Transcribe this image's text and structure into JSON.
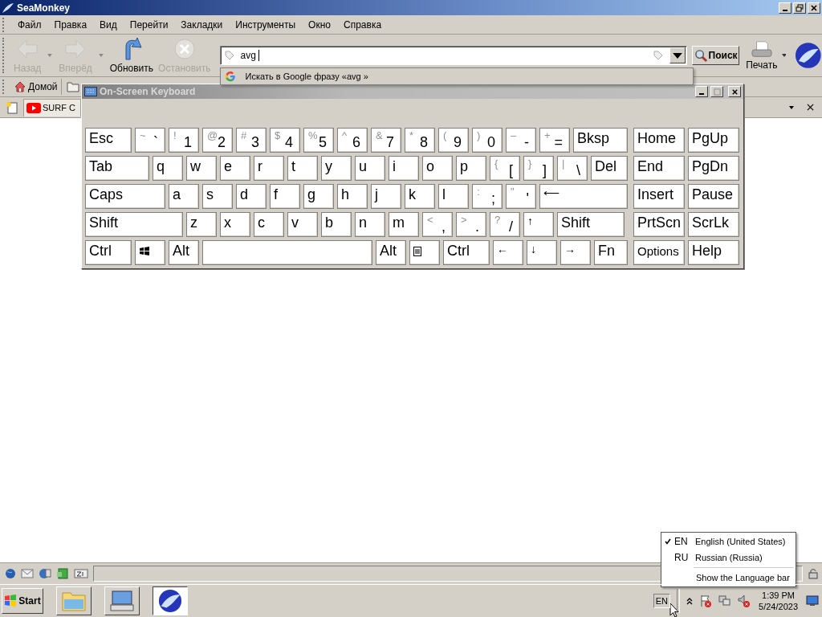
{
  "window": {
    "title": "SeaMonkey"
  },
  "menu": [
    "Файл",
    "Правка",
    "Вид",
    "Перейти",
    "Закладки",
    "Инструменты",
    "Окно",
    "Справка"
  ],
  "nav_buttons": [
    {
      "kind": "back",
      "label": "Назад",
      "disabled": true,
      "dropdown": true
    },
    {
      "kind": "forward",
      "label": "Вперёд",
      "disabled": true,
      "dropdown": true
    },
    {
      "kind": "reload",
      "label": "Обновить",
      "disabled": false,
      "dropdown": false
    },
    {
      "kind": "stop",
      "label": "Остановить",
      "disabled": true,
      "dropdown": false
    }
  ],
  "url": {
    "value": "avg"
  },
  "suggestion": {
    "text": "Искать в Google фразу «avg »"
  },
  "search_button": "Поиск",
  "print_button": "Печать",
  "bookmarks": [
    {
      "label": "Домой"
    }
  ],
  "tabs": [
    {
      "label": "SURF C",
      "selected": true
    }
  ],
  "keyboard": {
    "title": "On-Screen Keyboard",
    "main_rows": [
      [
        {
          "label": "Esc"
        },
        {
          "shift": "~",
          "label": "`"
        },
        {
          "shift": "!",
          "label": "1"
        },
        {
          "shift": "@",
          "label": "2"
        },
        {
          "shift": "#",
          "label": "3"
        },
        {
          "shift": "$",
          "label": "4"
        },
        {
          "shift": "%",
          "label": "5"
        },
        {
          "shift": "^",
          "label": "6"
        },
        {
          "shift": "&",
          "label": "7"
        },
        {
          "shift": "*",
          "label": "8"
        },
        {
          "shift": "(",
          "label": "9"
        },
        {
          "shift": ")",
          "label": "0"
        },
        {
          "shift": "–",
          "label": "-"
        },
        {
          "shift": "+",
          "label": "="
        },
        {
          "label": "Bksp"
        }
      ],
      [
        {
          "label": "Tab"
        },
        {
          "label": "q"
        },
        {
          "label": "w"
        },
        {
          "label": "e"
        },
        {
          "label": "r"
        },
        {
          "label": "t"
        },
        {
          "label": "y"
        },
        {
          "label": "u"
        },
        {
          "label": "i"
        },
        {
          "label": "o"
        },
        {
          "label": "p"
        },
        {
          "shift": "{",
          "label": "["
        },
        {
          "shift": "}",
          "label": "]"
        },
        {
          "shift": "|",
          "label": "\\"
        },
        {
          "label": "Del"
        }
      ],
      [
        {
          "label": "Caps"
        },
        {
          "label": "a"
        },
        {
          "label": "s"
        },
        {
          "label": "d"
        },
        {
          "label": "f"
        },
        {
          "label": "g"
        },
        {
          "label": "h"
        },
        {
          "label": "j"
        },
        {
          "label": "k"
        },
        {
          "label": "l"
        },
        {
          "shift": ":",
          "label": ";"
        },
        {
          "shift": "\"",
          "label": "'"
        },
        {
          "kind": "small",
          "label": "⟵"
        }
      ],
      [
        {
          "label": "Shift"
        },
        {
          "label": "z"
        },
        {
          "label": "x"
        },
        {
          "label": "c"
        },
        {
          "label": "v"
        },
        {
          "label": "b"
        },
        {
          "label": "n"
        },
        {
          "label": "m"
        },
        {
          "shift": "<",
          "label": ","
        },
        {
          "shift": ">",
          "label": "."
        },
        {
          "shift": "?",
          "label": "/"
        },
        {
          "kind": "small",
          "label": "↑"
        },
        {
          "label": "Shift"
        }
      ],
      [
        {
          "label": "Ctrl"
        },
        {
          "kind": "windows"
        },
        {
          "label": "Alt"
        },
        {
          "kind": "space"
        },
        {
          "label": "Alt"
        },
        {
          "kind": "menu"
        },
        {
          "label": "Ctrl"
        },
        {
          "kind": "small",
          "label": "←"
        },
        {
          "kind": "small",
          "label": "↓"
        },
        {
          "kind": "small",
          "label": "→"
        },
        {
          "label": "Fn"
        }
      ]
    ],
    "side_rows": [
      [
        "Home",
        "PgUp"
      ],
      [
        "End",
        "PgDn"
      ],
      [
        "Insert",
        "Pause"
      ],
      [
        "PrtScn",
        "ScrLk"
      ],
      [
        "Options",
        "Help"
      ]
    ]
  },
  "taskbar": {
    "start": "Start",
    "tasks": [
      {
        "kind": "folder",
        "selected": false
      },
      {
        "kind": "keyboard",
        "selected": false
      },
      {
        "kind": "seamonkey",
        "selected": true
      }
    ],
    "language": "EN",
    "time": "1:39 PM",
    "date": "5/24/2023"
  },
  "language_menu": {
    "items": [
      {
        "code": "EN",
        "name": "English (United States)",
        "checked": true
      },
      {
        "code": "RU",
        "name": "Russian (Russia)",
        "checked": false
      }
    ],
    "footer": "Show the Language bar"
  }
}
